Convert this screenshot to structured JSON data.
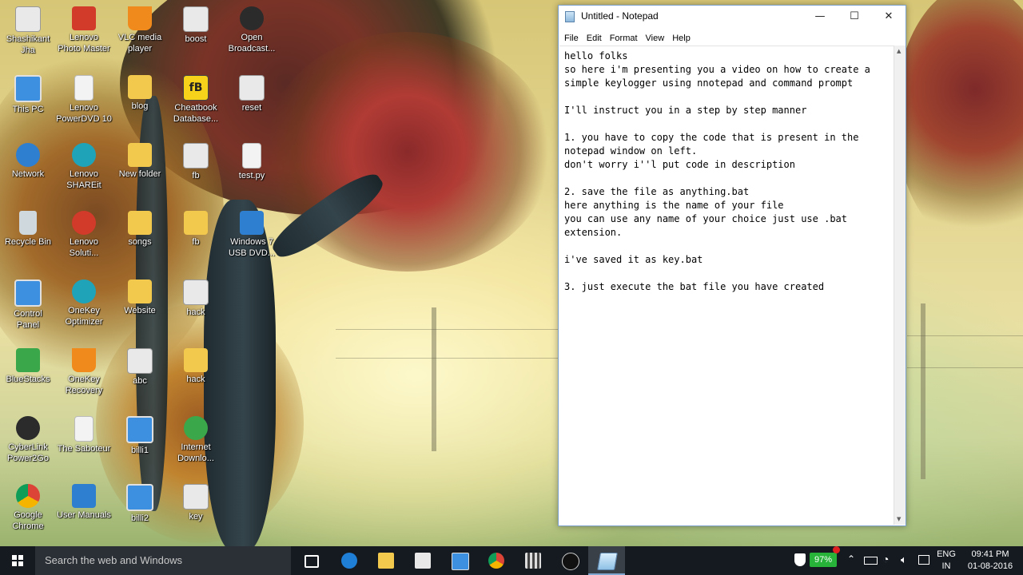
{
  "desktop": {
    "icons": [
      {
        "label": "Shashikant\nJha",
        "icon": "user-folder-icon"
      },
      {
        "label": "Lenovo\nPhoto Master",
        "icon": "lenovo-photo-icon"
      },
      {
        "label": "VLC media\nplayer",
        "icon": "vlc-icon"
      },
      {
        "label": "boost",
        "icon": "settings-file-icon"
      },
      {
        "label": "Open\nBroadcast...",
        "icon": "obs-icon"
      },
      {
        "label": "This PC",
        "icon": "computer-icon"
      },
      {
        "label": "Lenovo\nPowerDVD 10",
        "icon": "file-icon"
      },
      {
        "label": "blog",
        "icon": "folder-icon"
      },
      {
        "label": "Cheatbook\nDatabase...",
        "icon": "cheatbook-icon"
      },
      {
        "label": "reset",
        "icon": "settings-file-icon"
      },
      {
        "label": "Network",
        "icon": "network-icon"
      },
      {
        "label": "Lenovo\nSHAREit",
        "icon": "shareit-icon"
      },
      {
        "label": "New folder",
        "icon": "folder-icon"
      },
      {
        "label": "fb",
        "icon": "settings-file-icon"
      },
      {
        "label": "test.py",
        "icon": "file-icon"
      },
      {
        "label": "Recycle Bin",
        "icon": "recycle-bin-icon"
      },
      {
        "label": "Lenovo\nSoluti...",
        "icon": "lenovo-solution-icon"
      },
      {
        "label": "songs",
        "icon": "folder-icon"
      },
      {
        "label": "fb",
        "icon": "folder-icon"
      },
      {
        "label": "Windows 7\nUSB DVD...",
        "icon": "windows-usb-icon"
      },
      {
        "label": "Control\nPanel",
        "icon": "control-panel-icon"
      },
      {
        "label": "OneKey\nOptimizer",
        "icon": "onekey-optimizer-icon"
      },
      {
        "label": "Website",
        "icon": "folder-icon"
      },
      {
        "label": "hack",
        "icon": "settings-file-icon"
      },
      {
        "label": "BlueStacks",
        "icon": "bluestacks-icon"
      },
      {
        "label": "OneKey\nRecovery",
        "icon": "onekey-recovery-icon"
      },
      {
        "label": "abc",
        "icon": "settings-file-icon"
      },
      {
        "label": "hack",
        "icon": "folder-icon"
      },
      {
        "label": "CyberLink\nPower2Go",
        "icon": "cyberlink-icon"
      },
      {
        "label": "The Saboteur",
        "icon": "file-icon"
      },
      {
        "label": "billi1",
        "icon": "image-file-icon"
      },
      {
        "label": "Internet\nDownlo...",
        "icon": "idm-icon"
      },
      {
        "label": "Google\nChrome",
        "icon": "chrome-icon"
      },
      {
        "label": "User Manuals",
        "icon": "user-manuals-icon"
      },
      {
        "label": "billi2",
        "icon": "image-file-icon"
      },
      {
        "label": "key",
        "icon": "settings-file-icon"
      }
    ]
  },
  "notepad": {
    "title": "Untitled - Notepad",
    "controls": {
      "minimize": "—",
      "maximize": "☐",
      "close": "✕"
    },
    "menu": [
      "File",
      "Edit",
      "Format",
      "View",
      "Help"
    ],
    "lines": [
      "hello folks",
      "so here i'm presenting you a video on how to create a",
      "simple keylogger using nnotepad and command prompt",
      "",
      "I'll instruct you in a step by step manner",
      "",
      "1. you have to copy the code that is present in the",
      "notepad window on left.",
      "don't worry i''l put code in description",
      "",
      "2. save the file as anything.bat",
      "here anything is the name of your file",
      "you can use any name of your choice just use .bat",
      "extension.",
      "",
      "i've saved it as key.bat",
      "",
      "3. just execute the bat file you have created"
    ]
  },
  "taskbar": {
    "search_placeholder": "Search the web and Windows",
    "battery": "97%",
    "language": "ENG",
    "region": "IN",
    "time": "09:41 PM",
    "date": "01-08-2016",
    "apps": [
      "task-view-icon",
      "edge-icon",
      "file-explorer-icon",
      "store-icon",
      "monitor-app-icon",
      "chrome-icon",
      "clapper-icon",
      "obs-icon",
      "notepad-icon"
    ]
  }
}
